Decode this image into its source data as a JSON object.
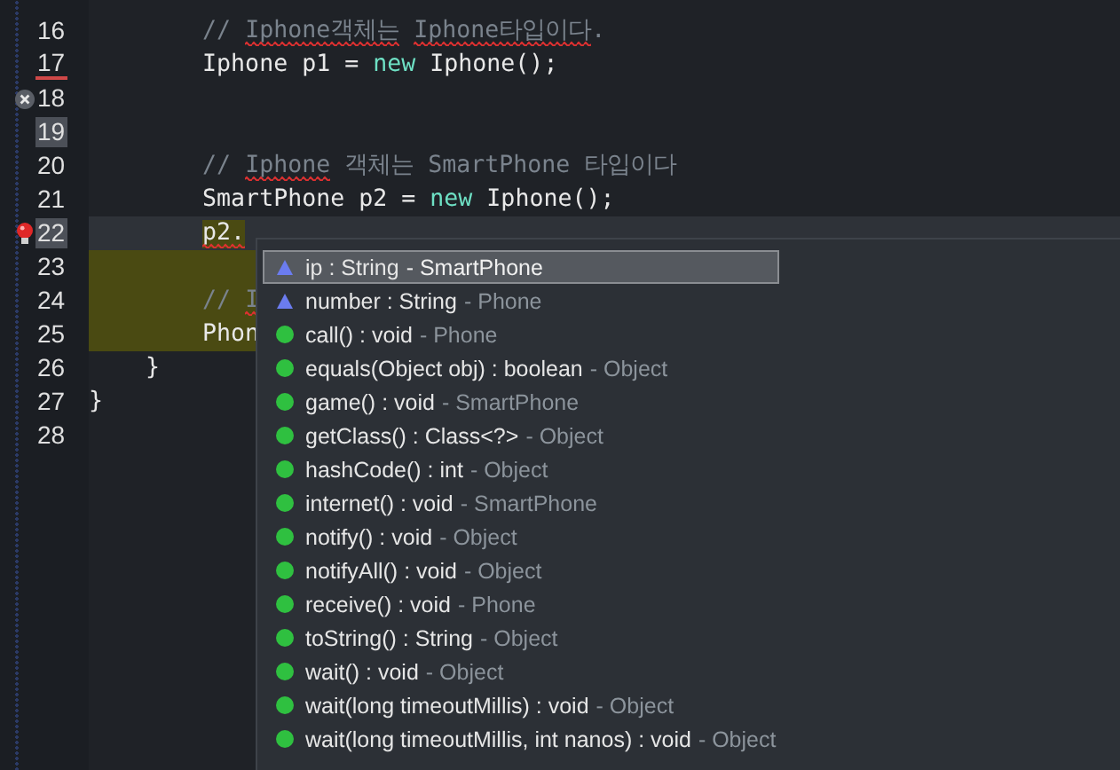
{
  "editor": {
    "lines": [
      {
        "number": "16",
        "error": false,
        "lightbulb": false,
        "number_highlighted": false,
        "number_underlined": false,
        "current": false,
        "occurrence": false,
        "tokens": [
          {
            "text": "        // ",
            "kind": "comment"
          },
          {
            "text": "Iphone객체는",
            "kind": "comment-error"
          },
          {
            "text": " Iphone타입이다",
            "kind": "comment-error"
          },
          {
            "text": ".",
            "kind": "comment"
          }
        ]
      },
      {
        "number": "17",
        "error": false,
        "lightbulb": false,
        "number_highlighted": false,
        "number_underlined": true,
        "current": false,
        "occurrence": false,
        "tokens": [
          {
            "text": "        Iphone p1 = ",
            "kind": "plain"
          },
          {
            "text": "new",
            "kind": "keyword"
          },
          {
            "text": " Iphone();",
            "kind": "plain"
          }
        ]
      },
      {
        "number": "18",
        "error": true,
        "lightbulb": false,
        "number_highlighted": false,
        "number_underlined": false,
        "current": false,
        "occurrence": false
      },
      {
        "number": "19",
        "error": false,
        "lightbulb": false,
        "number_highlighted": true,
        "number_underlined": false,
        "current": false,
        "occurrence": false
      },
      {
        "number": "20",
        "error": false,
        "lightbulb": false,
        "number_highlighted": false,
        "number_underlined": false,
        "current": false,
        "occurrence": false,
        "tokens": [
          {
            "text": "        // ",
            "kind": "comment"
          },
          {
            "text": "Iphone",
            "kind": "comment-error"
          },
          {
            "text": " 객체는 SmartPhone 타입이다",
            "kind": "comment"
          }
        ]
      },
      {
        "number": "21",
        "error": false,
        "lightbulb": false,
        "number_highlighted": false,
        "number_underlined": false,
        "current": false,
        "occurrence": false,
        "tokens": [
          {
            "text": "        SmartPhone p2 = ",
            "kind": "plain"
          },
          {
            "text": "new",
            "kind": "keyword"
          },
          {
            "text": " Iphone();",
            "kind": "plain"
          }
        ]
      },
      {
        "number": "22",
        "error": false,
        "lightbulb": true,
        "number_highlighted": true,
        "number_underlined": false,
        "current": true,
        "occurrence": false,
        "tokens": [
          {
            "text": "        p2.",
            "kind": "marked-error"
          }
        ]
      },
      {
        "number": "23",
        "error": false,
        "lightbulb": false,
        "number_highlighted": false,
        "number_underlined": false,
        "current": false,
        "occurrence": true
      },
      {
        "number": "24",
        "error": false,
        "lightbulb": false,
        "number_highlighted": false,
        "number_underlined": false,
        "current": false,
        "occurrence": true,
        "tokens": [
          {
            "text": "        // ",
            "kind": "comment"
          },
          {
            "text": "I",
            "kind": "comment-error"
          }
        ]
      },
      {
        "number": "25",
        "error": false,
        "lightbulb": false,
        "number_highlighted": false,
        "number_underlined": false,
        "current": false,
        "occurrence": true,
        "tokens": [
          {
            "text": "        Phon",
            "kind": "plain"
          }
        ]
      },
      {
        "number": "26",
        "error": false,
        "lightbulb": false,
        "number_highlighted": false,
        "number_underlined": false,
        "current": false,
        "occurrence": false,
        "tokens": [
          {
            "text": "    }",
            "kind": "plain"
          }
        ]
      },
      {
        "number": "27",
        "error": false,
        "lightbulb": false,
        "number_highlighted": false,
        "number_underlined": false,
        "current": false,
        "occurrence": false,
        "tokens": [
          {
            "text": "}",
            "kind": "plain"
          }
        ]
      },
      {
        "number": "28",
        "error": false,
        "lightbulb": false,
        "number_highlighted": false,
        "number_underlined": false,
        "current": false,
        "occurrence": false
      }
    ]
  },
  "completion": {
    "items": [
      {
        "kind": "field",
        "signature": "ip : String",
        "owner": "- SmartPhone",
        "selected": true
      },
      {
        "kind": "field",
        "signature": "number : String",
        "owner": "- Phone",
        "selected": false
      },
      {
        "kind": "method",
        "signature": "call() : void",
        "owner": "- Phone",
        "selected": false
      },
      {
        "kind": "method",
        "signature": "equals(Object obj) : boolean",
        "owner": "- Object",
        "selected": false
      },
      {
        "kind": "method",
        "signature": "game() : void",
        "owner": "- SmartPhone",
        "selected": false
      },
      {
        "kind": "method",
        "signature": "getClass() : Class<?>",
        "owner": "- Object",
        "selected": false
      },
      {
        "kind": "method",
        "signature": "hashCode() : int",
        "owner": "- Object",
        "selected": false
      },
      {
        "kind": "method",
        "signature": "internet() : void",
        "owner": "- SmartPhone",
        "selected": false
      },
      {
        "kind": "method",
        "signature": "notify() : void",
        "owner": "- Object",
        "selected": false
      },
      {
        "kind": "method",
        "signature": "notifyAll() : void",
        "owner": "- Object",
        "selected": false
      },
      {
        "kind": "method",
        "signature": "receive() : void",
        "owner": "- Phone",
        "selected": false
      },
      {
        "kind": "method",
        "signature": "toString() : String",
        "owner": "- Object",
        "selected": false
      },
      {
        "kind": "method",
        "signature": "wait() : void",
        "owner": "- Object",
        "selected": false
      },
      {
        "kind": "method",
        "signature": "wait(long timeoutMillis) : void",
        "owner": "- Object",
        "selected": false
      },
      {
        "kind": "method",
        "signature": "wait(long timeoutMillis, int nanos) : void",
        "owner": "- Object",
        "selected": false
      }
    ]
  }
}
